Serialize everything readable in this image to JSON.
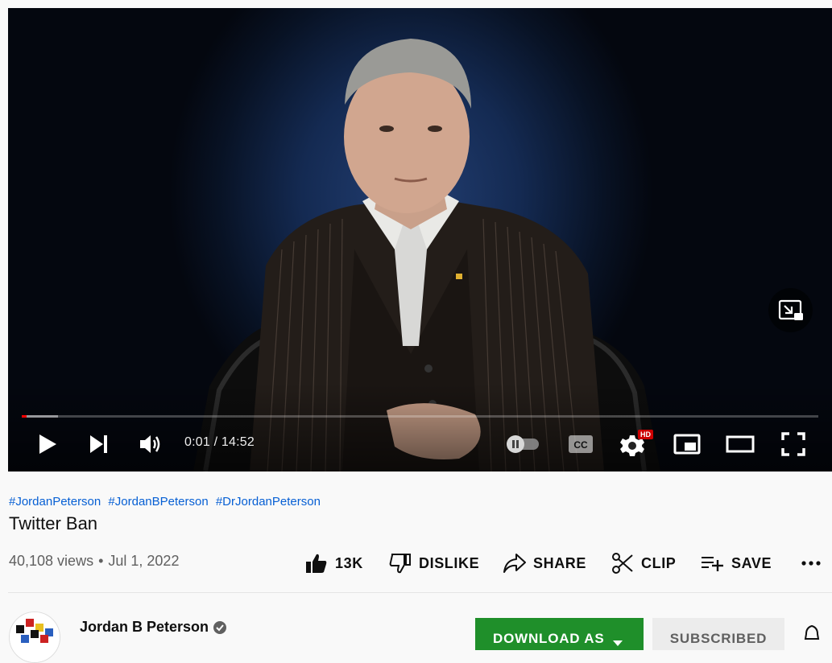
{
  "player": {
    "time_display": "0:01 / 14:52",
    "progress_fraction": 0.0011,
    "buffered_fraction": 0.045,
    "hd_badge": "HD",
    "autoplay": "paused",
    "accent_color": "#ff0000"
  },
  "video": {
    "hashtags": [
      "#JordanPeterson",
      "#JordanBPeterson",
      "#DrJordanPeterson"
    ],
    "title": "Twitter Ban",
    "views": "40,108 views",
    "date": "Jul 1, 2022"
  },
  "actions": {
    "like_count": "13K",
    "dislike_label": "DISLIKE",
    "share_label": "SHARE",
    "clip_label": "CLIP",
    "save_label": "SAVE"
  },
  "channel": {
    "name": "Jordan B Peterson",
    "verified": true,
    "download_label": "DOWNLOAD AS",
    "subscribed_label": "SUBSCRIBED"
  },
  "icons": {
    "play": "play-icon",
    "next": "next-icon",
    "volume": "volume-icon",
    "autoplay": "autoplay-toggle-icon",
    "captions": "cc-icon",
    "settings": "gear-icon",
    "miniplayer": "miniplayer-icon",
    "theater": "theater-mode-icon",
    "fullscreen": "fullscreen-icon",
    "pip": "picture-in-picture-icon",
    "like": "thumbs-up-icon",
    "dislike": "thumbs-down-icon",
    "share": "share-arrow-icon",
    "clip": "scissors-icon",
    "save": "playlist-add-icon",
    "more": "more-horizontal-icon",
    "verified": "verified-check-icon",
    "bell": "bell-icon"
  }
}
